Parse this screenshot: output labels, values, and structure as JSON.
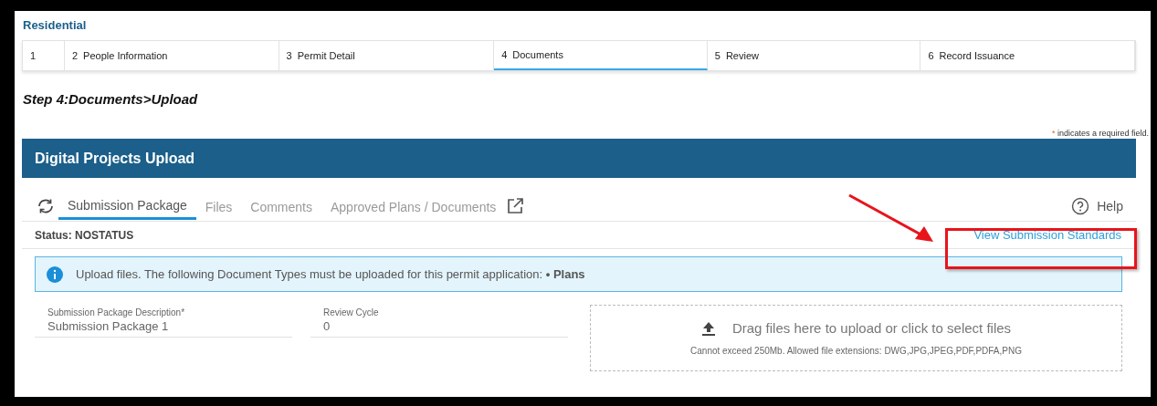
{
  "record_type": "Residential",
  "steps": [
    {
      "number": "1",
      "selected": false
    },
    {
      "number": "2",
      "label": "People Information",
      "selected": false
    },
    {
      "number": "3",
      "label": "Permit Detail",
      "selected": false
    },
    {
      "number": "4",
      "label": "Documents",
      "selected": true
    },
    {
      "number": "5",
      "label": "Review",
      "selected": false
    },
    {
      "number": "6",
      "label": "Record Issuance",
      "selected": false
    }
  ],
  "step_title": "Step 4:Documents>Upload",
  "required_note": {
    "mark": "*",
    "text": "indicates a required field."
  },
  "panel_title": "Digital Projects Upload",
  "tabs": [
    {
      "label": "Submission Package",
      "selected": true
    },
    {
      "label": "Files",
      "selected": false
    },
    {
      "label": "Comments",
      "selected": false
    },
    {
      "label": "Approved Plans / Documents",
      "selected": false
    }
  ],
  "help": "Help",
  "status": "Status: NOSTATUS",
  "standards_link": {
    "label": "View Submission Standards",
    "highlighted": true
  },
  "info_banner": "Upload files. The following Document Types must be uploaded for this permit application: **• Plans**",
  "fields": [
    {
      "label": "Submission Package Description*",
      "value": "Submission Package 1"
    },
    {
      "label": "Review Cycle",
      "value": "0"
    }
  ],
  "dropzone": {
    "title": "Drag files here to upload or click to select files",
    "note": "Cannot exceed 250Mb. Allowed file extensions: DWG,JPG,JPEG,PDF,PDFA,PNG"
  }
}
